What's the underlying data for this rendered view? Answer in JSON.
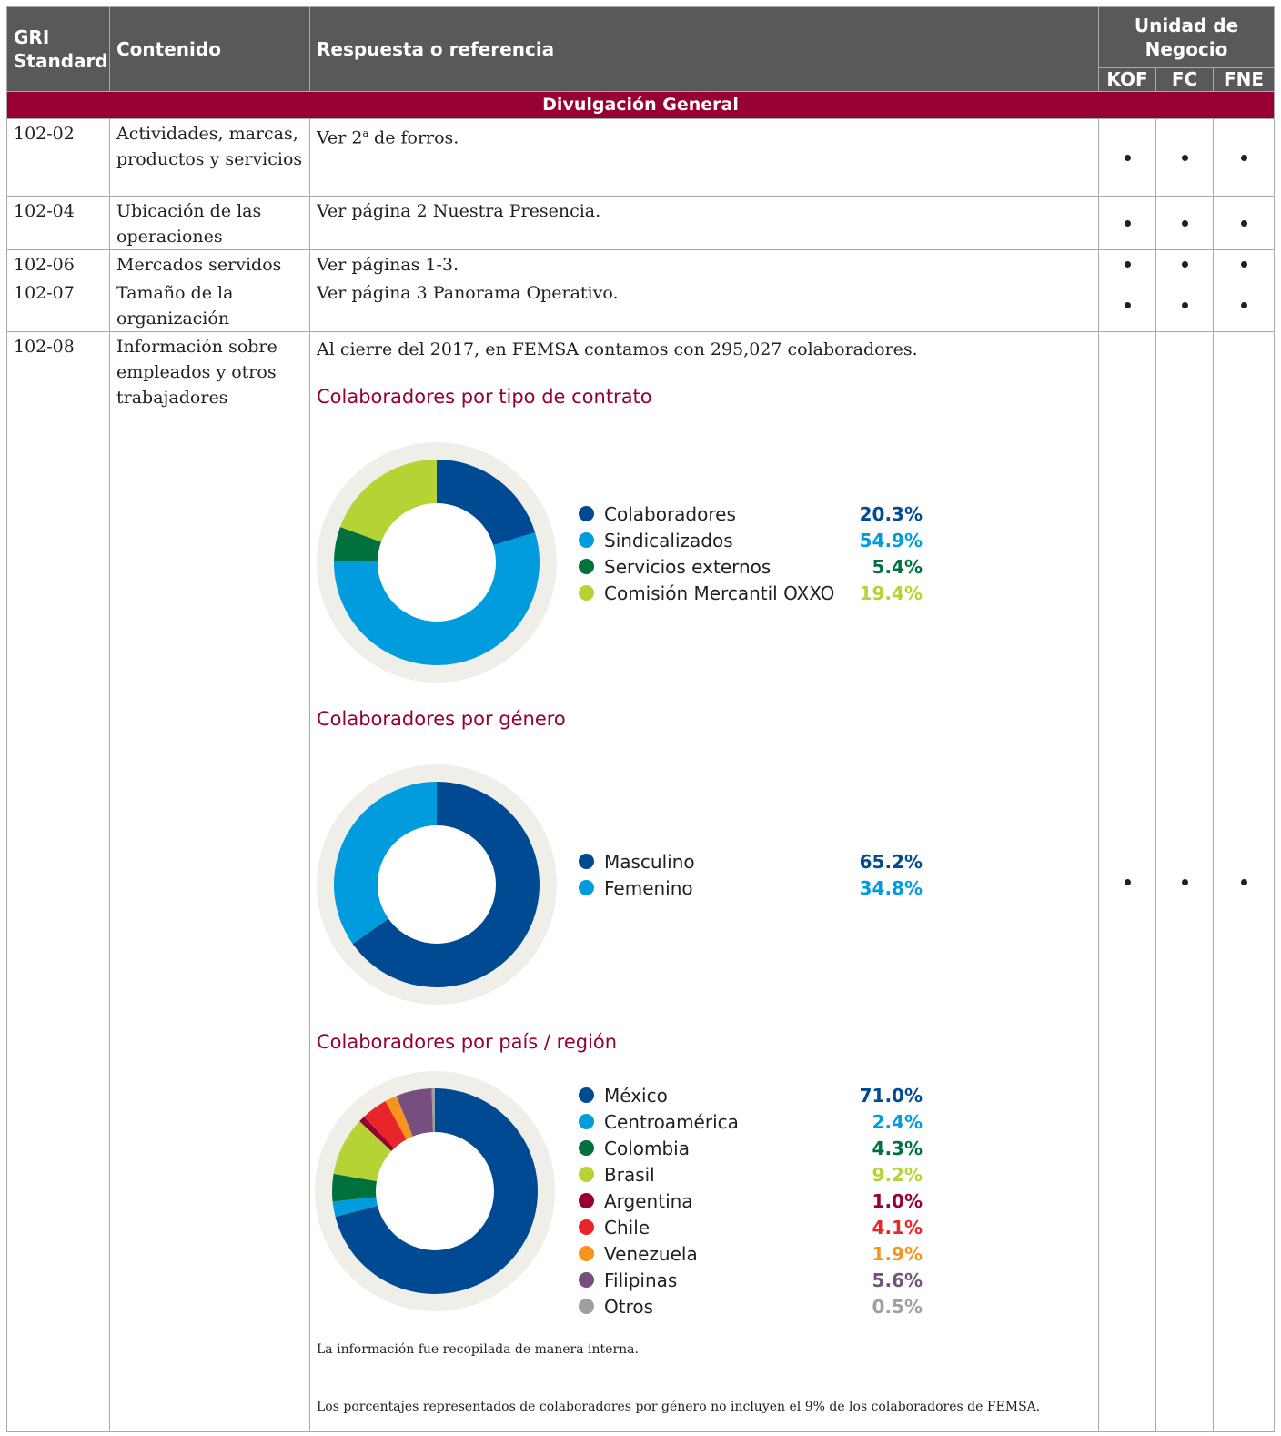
{
  "header": {
    "gri_standard": "GRI Standard",
    "contenido": "Contenido",
    "respuesta": "Respuesta o referencia",
    "unidad": "Unidad de Negocio",
    "units": [
      "KOF",
      "FC",
      "FNE"
    ]
  },
  "section_title": "Divulgación General",
  "rows": [
    {
      "code": "102-02",
      "content": "Actividades, marcas, productos y servicios",
      "response": "Ver 2",
      "response_sup": "a",
      "response_tail": " de forros."
    },
    {
      "code": "102-04",
      "content": "Ubicación de las operaciones",
      "response": "Ver página 2 Nuestra Presencia."
    },
    {
      "code": "102-06",
      "content": "Mercados servidos",
      "response": "Ver páginas 1-3."
    },
    {
      "code": "102-07",
      "content": "Tamaño de la organización",
      "response": "Ver página 3 Panorama Operativo."
    }
  ],
  "employees_row": {
    "code": "102-08",
    "content": "Información sobre empleados y otros trabajadores",
    "intro": "Al cierre del 2017, en FEMSA contamos con 295,027 colaboradores.",
    "note1": "La información fue recopilada de manera interna.",
    "note2": "Los porcentajes representados de colaboradores por género no incluyen el 9% de los colaboradores de FEMSA."
  },
  "dot_symbol": "•",
  "chart_data": [
    {
      "type": "pie",
      "title": "Colaboradores por tipo de contrato",
      "categories": [
        "Colaboradores",
        "Sindicalizados",
        "Servicios externos",
        "Comisión Mercantil OXXO"
      ],
      "values": [
        20.3,
        54.9,
        5.4,
        19.4
      ],
      "labels": [
        "20.3%",
        "54.9%",
        "5.4%",
        "19.4%"
      ],
      "colors": [
        "#004a93",
        "#009cde",
        "#00703c",
        "#b5d334"
      ]
    },
    {
      "type": "pie",
      "title": "Colaboradores por género",
      "categories": [
        "Masculino",
        "Femenino"
      ],
      "values": [
        65.2,
        34.8
      ],
      "labels": [
        "65.2%",
        "34.8%"
      ],
      "colors": [
        "#004a93",
        "#009cde"
      ]
    },
    {
      "type": "pie",
      "title": "Colaboradores por país / región",
      "categories": [
        "México",
        "Centroamérica",
        "Colombia",
        "Brasil",
        "Argentina",
        "Chile",
        "Venezuela",
        "Filipinas",
        "Otros"
      ],
      "values": [
        71.0,
        2.4,
        4.3,
        9.2,
        1.0,
        4.1,
        1.9,
        5.6,
        0.5
      ],
      "labels": [
        "71.0%",
        "2.4%",
        "4.3%",
        "9.2%",
        "1.0%",
        "4.1%",
        "1.9%",
        "5.6%",
        "0.5%"
      ],
      "colors": [
        "#004a93",
        "#009cde",
        "#00703c",
        "#b5d334",
        "#960032",
        "#e8262a",
        "#f7941d",
        "#774f7f",
        "#9d9fa2"
      ]
    }
  ],
  "ring_color": "#efeee9"
}
